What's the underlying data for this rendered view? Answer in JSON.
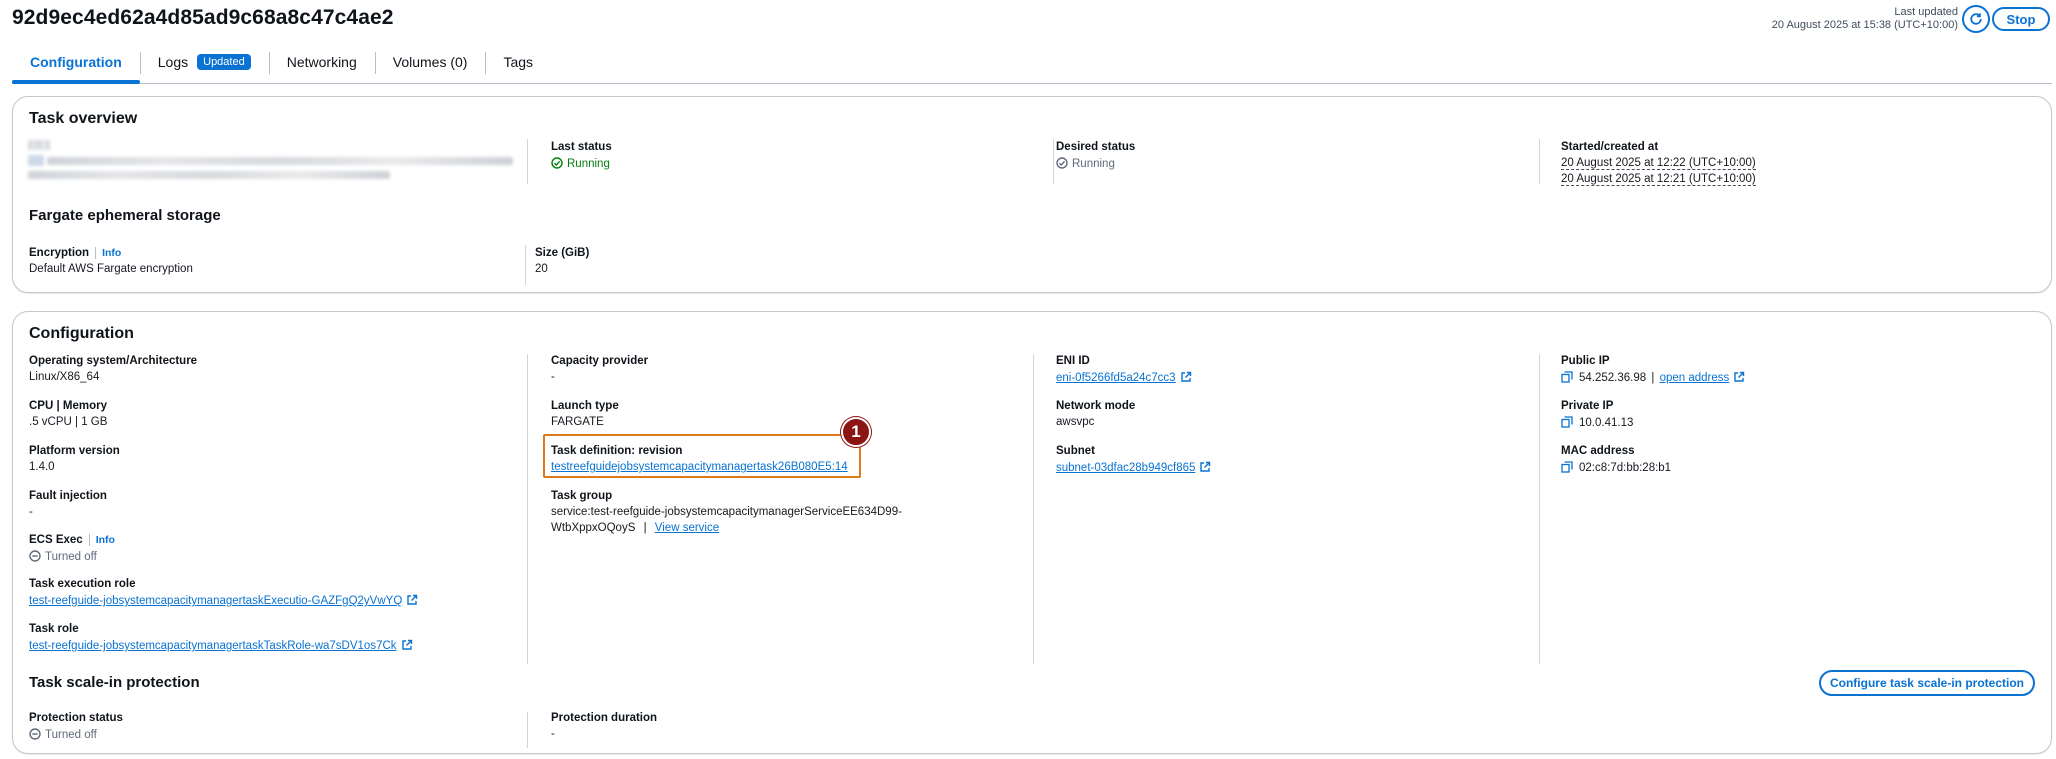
{
  "header": {
    "title": "92d9ec4ed62a4d85ad9c68a8c47c4ae2",
    "last_updated_label": "Last updated",
    "last_updated_value": "20 August 2025 at 15:38 (UTC+10:00)",
    "stop_label": "Stop"
  },
  "tabs": [
    {
      "label": "Configuration"
    },
    {
      "label": "Logs",
      "badge": "Updated"
    },
    {
      "label": "Networking"
    },
    {
      "label": "Volumes (0)"
    },
    {
      "label": "Tags"
    }
  ],
  "task_overview": {
    "title": "Task overview",
    "last_status": {
      "label": "Last status",
      "value": "Running"
    },
    "desired_status": {
      "label": "Desired status",
      "value": "Running"
    },
    "started": {
      "label": "Started/created at",
      "started_value": "20 August 2025 at 12:22 (UTC+10:00)",
      "created_value": "20 August 2025 at 12:21 (UTC+10:00)"
    },
    "storage_title": "Fargate ephemeral storage",
    "encryption": {
      "label": "Encryption",
      "info": "Info",
      "value": "Default AWS Fargate encryption"
    },
    "size": {
      "label": "Size (GiB)",
      "value": "20"
    }
  },
  "configuration": {
    "title": "Configuration",
    "os": {
      "label": "Operating system/Architecture",
      "value": "Linux/X86_64"
    },
    "cpu": {
      "label": "CPU | Memory",
      "value": ".5 vCPU | 1 GB"
    },
    "platform": {
      "label": "Platform version",
      "value": "1.4.0"
    },
    "fault": {
      "label": "Fault injection",
      "value": "-"
    },
    "ecs_exec": {
      "label": "ECS Exec",
      "info": "Info",
      "value": "Turned off"
    },
    "exec_role": {
      "label": "Task execution role",
      "value": "test-reefguide-jobsystemcapacitymanagertaskExecutio-GAZFgQ2yVwYQ"
    },
    "task_role": {
      "label": "Task role",
      "value": "test-reefguide-jobsystemcapacitymanagertaskTaskRole-wa7sDV1os7Ck"
    },
    "capacity": {
      "label": "Capacity provider",
      "value": "-"
    },
    "launch": {
      "label": "Launch type",
      "value": "FARGATE"
    },
    "task_def": {
      "label": "Task definition: revision",
      "value": "testreefguidejobsystemcapacitymanagertask26B080E5:14"
    },
    "task_group": {
      "label": "Task group",
      "line1": "service:test-reefguide-jobsystemcapacitymanagerServiceEE634D99-",
      "line2": "WtbXppxOQoyS",
      "separator": "|",
      "view_service": "View service"
    },
    "eni": {
      "label": "ENI ID",
      "value": "eni-0f5266fd5a24c7cc3"
    },
    "network_mode": {
      "label": "Network mode",
      "value": "awsvpc"
    },
    "subnet": {
      "label": "Subnet",
      "value": "subnet-03dfac28b949cf865"
    },
    "public_ip": {
      "label": "Public IP",
      "value": "54.252.36.98",
      "separator": "|",
      "open": "open address"
    },
    "private_ip": {
      "label": "Private IP",
      "value": "10.0.41.13"
    },
    "mac": {
      "label": "MAC address",
      "value": "02:c8:7d:bb:28:b1"
    },
    "scale_in_title": "Task scale-in protection",
    "configure_button": "Configure task scale-in protection",
    "protection_status": {
      "label": "Protection status",
      "value": "Turned off"
    },
    "protection_duration": {
      "label": "Protection duration",
      "value": "-"
    }
  },
  "annotation": {
    "marker": "1"
  },
  "colors": {
    "accent": "#0972d3",
    "success": "#037f0c",
    "highlight": "#e0791a",
    "marker": "#8b1414"
  }
}
